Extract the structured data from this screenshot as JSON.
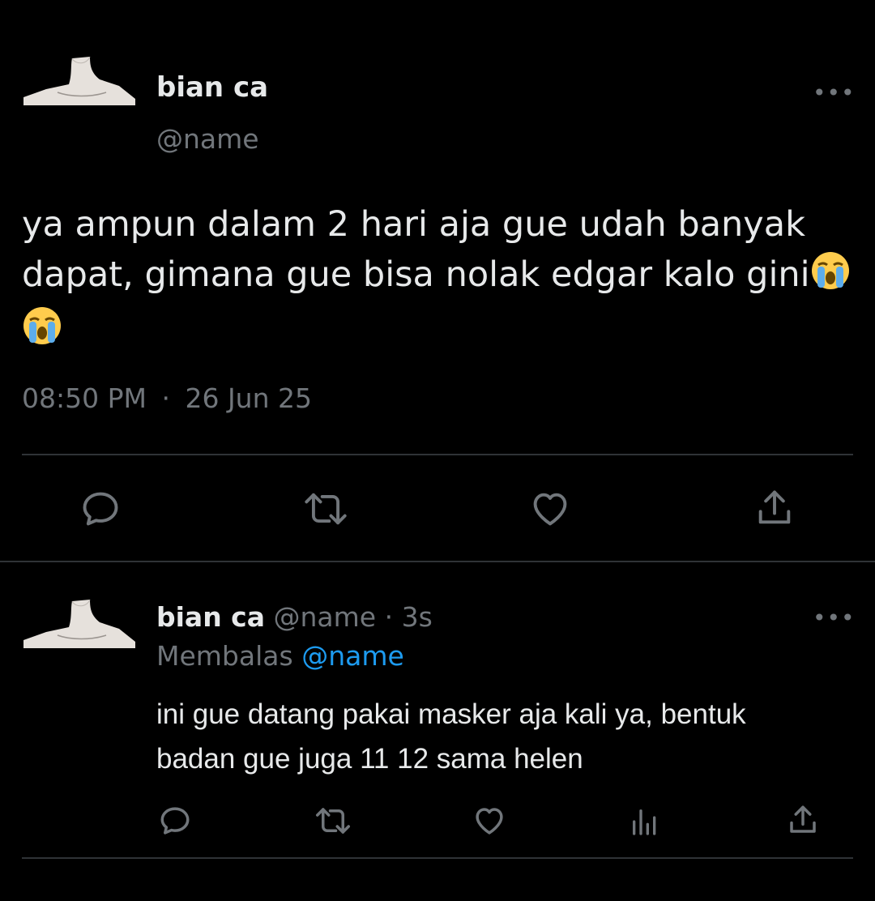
{
  "main_tweet": {
    "display_name": "bian ca",
    "handle": "@name",
    "text": "ya ampun dalam 2 hari aja gue udah banyak dapat, gimana gue bisa nolak edgar kalo gini",
    "time": "08:50 PM",
    "separator": "·",
    "date": "26 Jun 25",
    "more_label": "•••"
  },
  "reply_tweet": {
    "display_name": "bian ca",
    "handle": "@name",
    "separator": "·",
    "age": "3s",
    "replying_label": "Membalas",
    "replying_to": "@name",
    "text_line1": "ini gue datang pakai masker aja kali ya, bentuk",
    "text_line2": "badan gue juga 11 12 sama helen",
    "more_label": "•••"
  },
  "icons": {
    "reply": "reply-icon",
    "retweet": "retweet-icon",
    "like": "heart-icon",
    "views": "views-icon",
    "share": "share-icon",
    "emoji": "loudly-crying-face-emoji"
  },
  "colors": {
    "background": "#000000",
    "text": "#e7e9ea",
    "muted": "#71767b",
    "link": "#1d9bf0",
    "divider": "#2f3336"
  }
}
